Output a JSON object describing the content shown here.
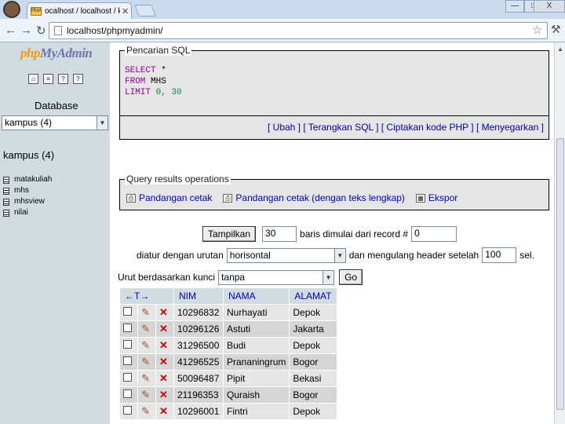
{
  "browser": {
    "tab_favicon": "PMA",
    "tab_title": "ocalhost / localhost / kampus",
    "url": "localhost/phpmyadmin/",
    "window_controls": [
      "—",
      "□",
      "X"
    ]
  },
  "left": {
    "logo_part1": "php",
    "logo_part2": "MyAdmin",
    "database_heading": "Database",
    "database_select": "kampus (4)",
    "db_title": "kampus (4)",
    "tables": [
      "matakuliah",
      "mhs",
      "mhsview",
      "nilai"
    ]
  },
  "sql_box": {
    "legend": "Pencarian SQL",
    "kw_select": "SELECT",
    "select_rest": " *",
    "kw_from": "FROM",
    "from_rest": " MHS",
    "kw_limit": "LIMIT",
    "limit_rest": " 0, 30",
    "links": [
      "[ Ubah ]",
      "[ Terangkan SQL ]",
      "[ Ciptakan kode PHP ]",
      "[ Menyegarkan ]"
    ]
  },
  "query_ops": {
    "legend": "Query results operations",
    "print_view": "Pandangan cetak",
    "print_view_full": "Pandangan cetak (dengan teks lengkap)",
    "export": "Ekspor"
  },
  "nav": {
    "show_button": "Tampilkan",
    "rows_value": "30",
    "rows_label": "baris dimulai dari record #",
    "start_value": "0",
    "mode_label": "diatur dengan urutan",
    "mode_value": "horisontal",
    "repeat_label": "dan mengulang header setelah",
    "repeat_value": "100",
    "repeat_unit": "sel.",
    "sort_label": "Urut berdasarkan kunci",
    "sort_value": "tanpa",
    "go_button": "Go"
  },
  "results": {
    "arrows": "←T→",
    "columns": [
      "NIM",
      "NAMA",
      "ALAMAT"
    ],
    "rows": [
      [
        "10296832",
        "Nurhayati",
        "Depok"
      ],
      [
        "10296126",
        "Astuti",
        "Jakarta"
      ],
      [
        "31296500",
        "Budi",
        "Depok"
      ],
      [
        "41296525",
        "Prananingrum",
        "Bogor"
      ],
      [
        "50096487",
        "Pipit",
        "Bekasi"
      ],
      [
        "21196353",
        "Quraish",
        "Bogor"
      ],
      [
        "10296001",
        "Fintri",
        "Depok"
      ]
    ]
  },
  "icons": {
    "edit": "pencil-icon",
    "delete": "delete-icon",
    "checkbox": "checkbox"
  }
}
